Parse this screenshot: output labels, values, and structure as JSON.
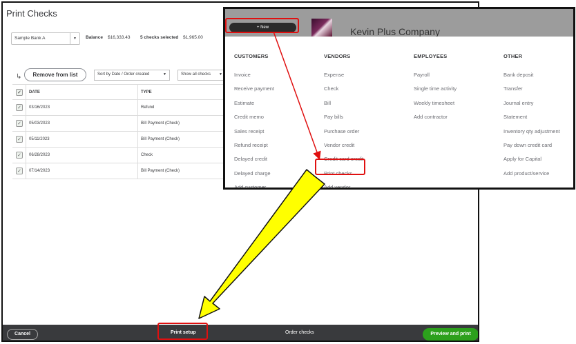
{
  "print_window": {
    "title": "Print Checks",
    "account": "Sample Bank A",
    "balance_label": "Balance",
    "balance_value": "$16,333.43",
    "selected_label": "5 checks selected",
    "selected_value": "$1,965.00",
    "remove_button": "Remove from list",
    "sort_select": "Sort by Date / Order created",
    "show_select": "Show all checks",
    "table": {
      "headers": [
        "DATE",
        "TYPE"
      ],
      "rows": [
        {
          "date": "03/16/2023",
          "type": "Refund"
        },
        {
          "date": "05/03/2023",
          "type": "Bill Payment (Check)"
        },
        {
          "date": "05/11/2023",
          "type": "Bill Payment (Check)"
        },
        {
          "date": "06/28/2023",
          "type": "Check"
        },
        {
          "date": "07/14/2023",
          "type": "Bill Payment (Check)"
        }
      ]
    },
    "footer": {
      "cancel": "Cancel",
      "print_setup": "Print setup",
      "order_checks": "Order checks",
      "preview_print": "Preview and print"
    }
  },
  "new_menu": {
    "new_button": "+ New",
    "company_name": "Kevin Plus Company",
    "columns": [
      {
        "title": "CUSTOMERS",
        "items": [
          "Invoice",
          "Receive payment",
          "Estimate",
          "Credit memo",
          "Sales receipt",
          "Refund receipt",
          "Delayed credit",
          "Delayed charge",
          "Add customer"
        ]
      },
      {
        "title": "VENDORS",
        "items": [
          "Expense",
          "Check",
          "Bill",
          "Pay bills",
          "Purchase order",
          "Vendor credit",
          "Credit card credit",
          "Print checks",
          "Add vendor"
        ]
      },
      {
        "title": "EMPLOYEES",
        "items": [
          "Payroll",
          "Single time activity",
          "Weekly timesheet",
          "Add contractor"
        ]
      },
      {
        "title": "OTHER",
        "items": [
          "Bank deposit",
          "Transfer",
          "Journal entry",
          "Statement",
          "Inventory qty adjustment",
          "Pay down credit card",
          "Apply for Capital",
          "Add product/service"
        ]
      }
    ]
  },
  "colors": {
    "annotation_red": "#e01010",
    "arrow_yellow": "#ffff00",
    "primary_green": "#2ca01c",
    "footer_dark": "#393a3d"
  }
}
